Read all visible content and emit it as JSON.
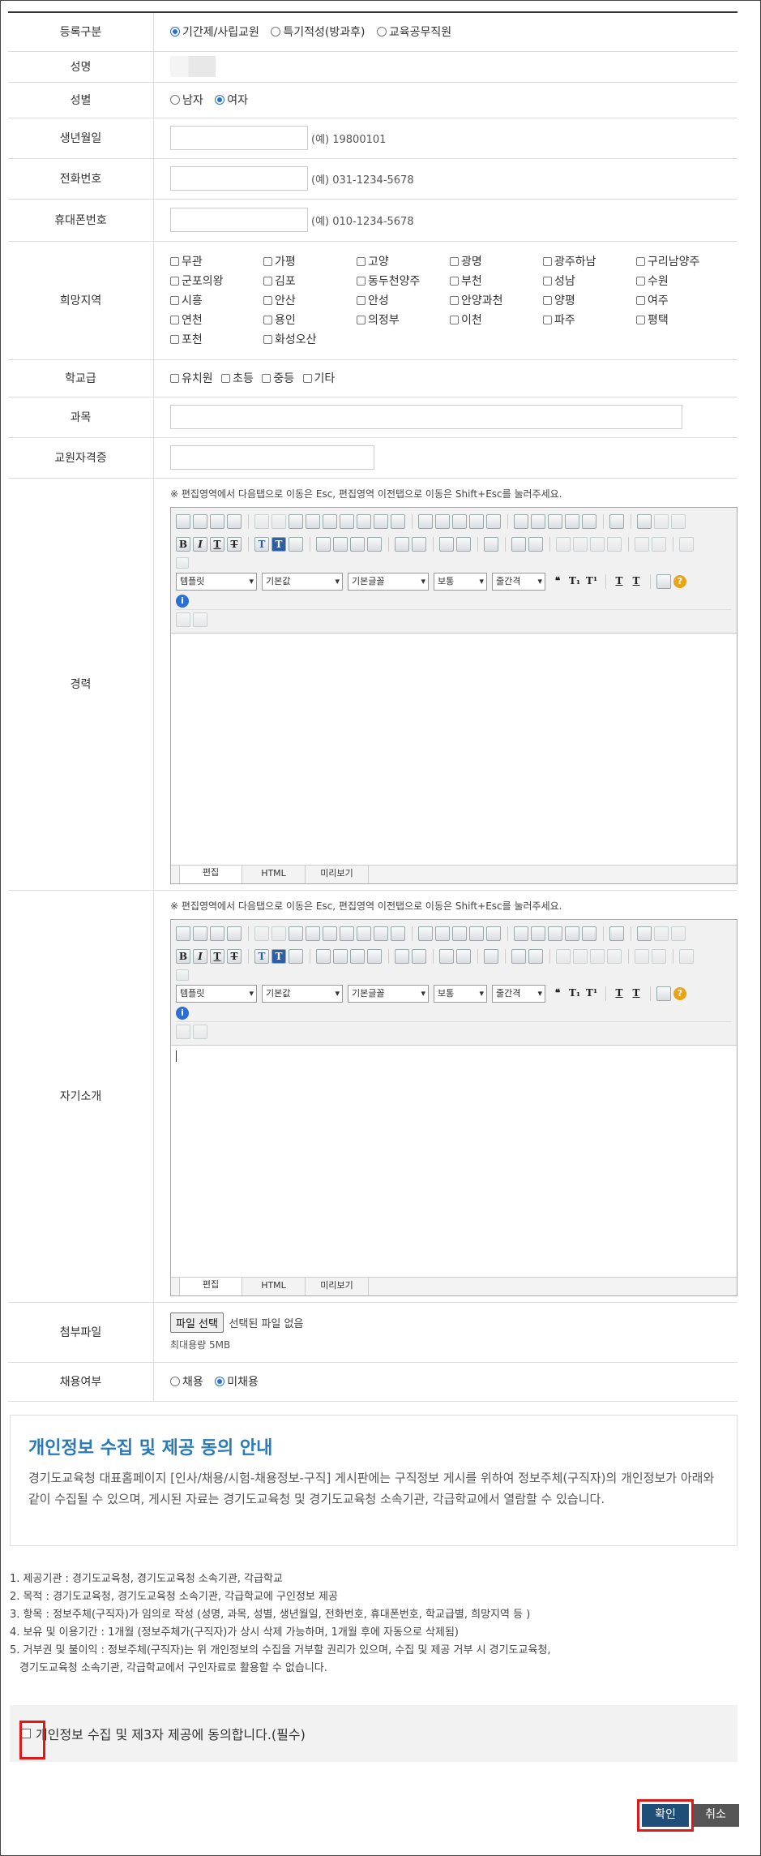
{
  "form": {
    "reg_type": {
      "label": "등록구분",
      "options": [
        "기간제/사립교원",
        "특기적성(방과후)",
        "교육공무직원"
      ],
      "selected": 0
    },
    "name": {
      "label": "성명"
    },
    "gender": {
      "label": "성별",
      "options": [
        "남자",
        "여자"
      ],
      "selected": 1
    },
    "birth": {
      "label": "생년월일",
      "example": "(예) 19800101"
    },
    "phone": {
      "label": "전화번호",
      "example": "(예) 031-1234-5678"
    },
    "mobile": {
      "label": "휴대폰번호",
      "example": "(예) 010-1234-5678"
    },
    "regions": {
      "label": "희망지역",
      "options": [
        "무관",
        "가평",
        "고양",
        "광명",
        "광주하남",
        "구리남양주",
        "군포의왕",
        "김포",
        "동두천양주",
        "부천",
        "성남",
        "수원",
        "시흥",
        "안산",
        "안성",
        "안양과천",
        "양평",
        "여주",
        "연천",
        "용인",
        "의정부",
        "이천",
        "파주",
        "평택",
        "포천",
        "화성오산"
      ]
    },
    "school_level": {
      "label": "학교급",
      "options": [
        "유치원",
        "초등",
        "중등",
        "기타"
      ]
    },
    "subject": {
      "label": "과목"
    },
    "license": {
      "label": "교원자격증"
    },
    "career": {
      "label": "경력"
    },
    "intro": {
      "label": "자기소개"
    },
    "editor": {
      "notice": "※ 편집영역에서 다음탭으로 이동은 Esc, 편집영역 이전탭으로 이동은 Shift+Esc를 눌러주세요.",
      "selects": [
        "템플릿",
        "기본값",
        "기본글꼴",
        "보통",
        "줄간격"
      ],
      "tabs": [
        "편집",
        "HTML",
        "미리보기"
      ]
    },
    "attachment": {
      "label": "첨부파일",
      "button": "파일 선택",
      "status": "선택된 파일 없음",
      "limit": "최대용량 5MB"
    },
    "hiring": {
      "label": "채용여부",
      "options": [
        "채용",
        "미채용"
      ],
      "selected": 1
    }
  },
  "privacy": {
    "title": "개인정보 수집 및 제공 동의 안내",
    "body": "경기도교육청 대표홈페이지 [인사/채용/시험-채용정보-구직] 게시판에는 구직정보 게시를 위하여 정보주체(구직자)의 개인정보가 아래와 같이 수집될 수 있으며, 게시된 자료는 경기도교육청 및 경기도교육청 소속기관, 각급학교에서 열람할 수 있습니다."
  },
  "terms": [
    "1. 제공기관 : 경기도교육청, 경기도교육청 소속기관, 각급학교",
    "2. 목적 : 경기도교육청, 경기도교육청 소속기관, 각급학교에 구인정보 제공",
    "3. 항목 : 정보주체(구직자)가 임의로 작성 (성명, 과목, 성별, 생년월일, 전화번호, 휴대폰번호, 학교급별, 희망지역 등 )",
    "4. 보유 및 이용기간 : 1개월 (정보주체가(구직자)가 상시 삭제 가능하며, 1개월 후에 자동으로 삭제됨)",
    "5. 거부권 및 불이익 : 정보주체(구직자)는 위 개인정보의 수집을 거부할 권리가 있으며, 수집 및 제공 거부 시 경기도교육청,",
    "   경기도교육청 소속기관, 각급학교에서 구인자료로 활용할 수 없습니다."
  ],
  "agree_label": "개인정보 수집 및 제3자 제공에 동의합니다.(필수)",
  "buttons": {
    "confirm": "확인",
    "cancel": "취소"
  },
  "colors": {
    "accent": "#2a7ab9",
    "confirm_bg": "#1f4e79",
    "cancel_bg": "#555555",
    "highlight": "#e01818"
  }
}
